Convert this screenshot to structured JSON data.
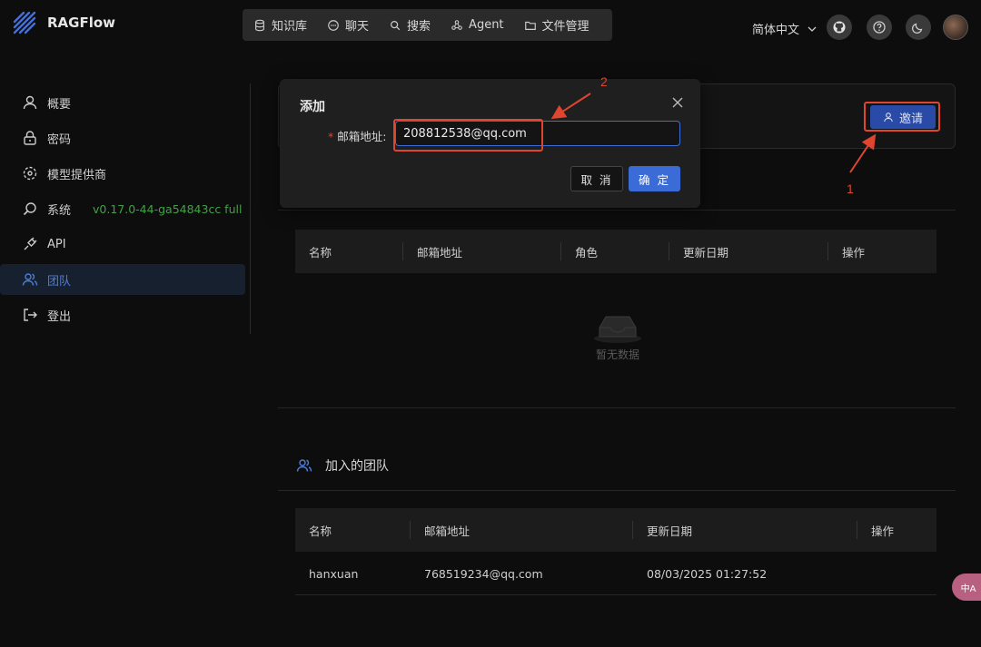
{
  "app": {
    "brand": "RAGFlow"
  },
  "topnav": {
    "items": [
      {
        "label": "知识库",
        "icon": "database-icon"
      },
      {
        "label": "聊天",
        "icon": "chat-icon"
      },
      {
        "label": "搜索",
        "icon": "search-icon"
      },
      {
        "label": "Agent",
        "icon": "agent-icon"
      },
      {
        "label": "文件管理",
        "icon": "folder-icon"
      }
    ]
  },
  "header": {
    "language": "简体中文"
  },
  "sidebar": {
    "items": [
      {
        "label": "概要",
        "icon": "user-icon"
      },
      {
        "label": "密码",
        "icon": "lock-icon"
      },
      {
        "label": "模型提供商",
        "icon": "model-icon"
      },
      {
        "label": "系统",
        "icon": "system-icon",
        "extra": "v0.17.0-44-ga54843cc full"
      },
      {
        "label": "API",
        "icon": "api-icon"
      },
      {
        "label": "团队",
        "icon": "team-icon",
        "active": true
      },
      {
        "label": "登出",
        "icon": "logout-icon"
      }
    ]
  },
  "team": {
    "invite_label": "邀请",
    "members_table": {
      "headers": [
        "名称",
        "邮箱地址",
        "角色",
        "更新日期",
        "操作"
      ],
      "empty_text": "暂无数据"
    },
    "joined_title": "加入的团队",
    "joined_table": {
      "headers": [
        "名称",
        "邮箱地址",
        "更新日期",
        "操作"
      ],
      "rows": [
        {
          "name": "hanxuan",
          "email": "768519234@qq.com",
          "updated": "08/03/2025 01:27:52",
          "action": ""
        }
      ]
    }
  },
  "modal": {
    "title": "添加",
    "field_label": "邮箱地址",
    "field_required": "*",
    "field_value": "208812538@qq.com",
    "cancel_label": "取 消",
    "ok_label": "确 定"
  },
  "annotations": {
    "one": "1",
    "two": "2",
    "color": "#e0452f"
  },
  "fab": {
    "label": "中A"
  },
  "colors": {
    "accent": "#3a6bd6",
    "active_text": "#4e7dd6",
    "version_green": "#43a047"
  }
}
